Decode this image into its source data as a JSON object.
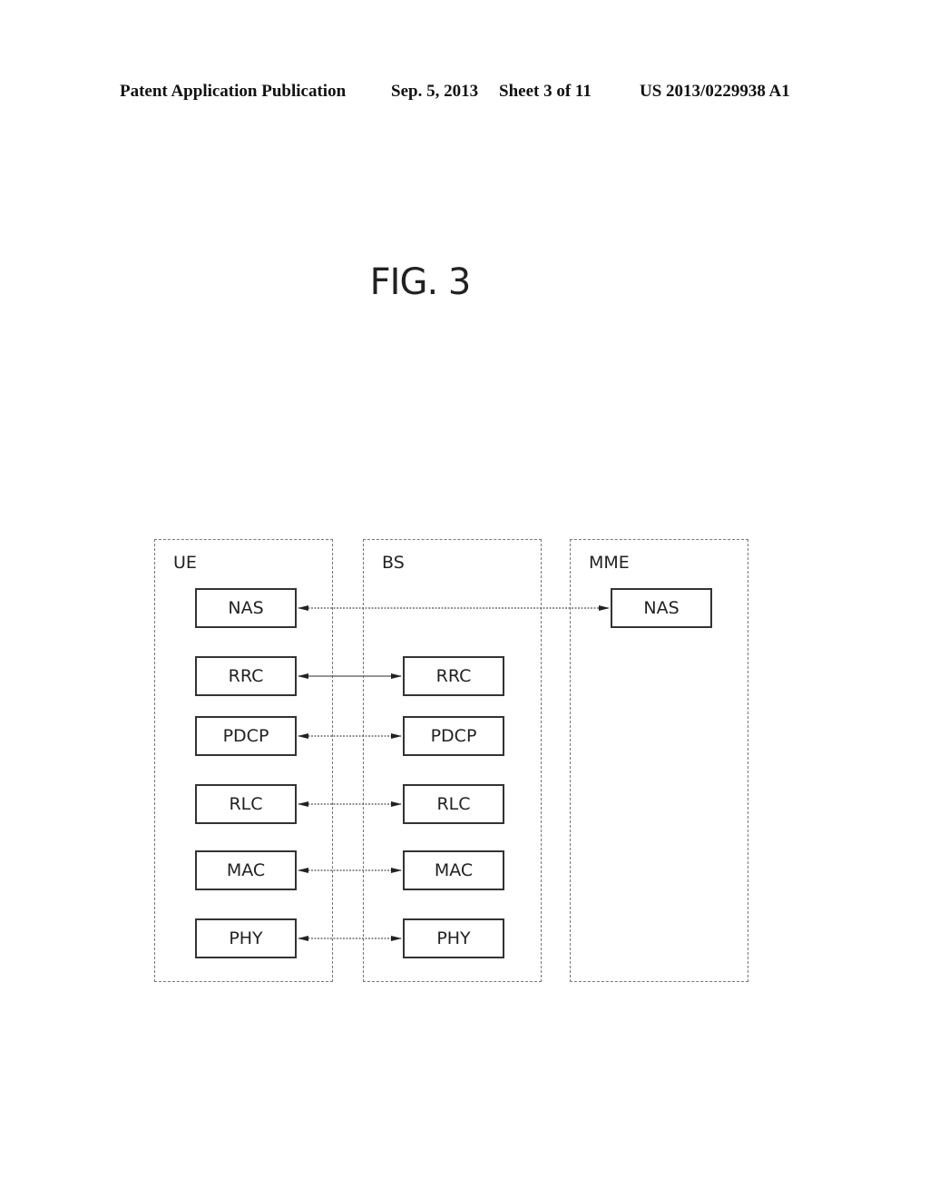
{
  "header": {
    "publication": "Patent Application Publication",
    "date": "Sep. 5, 2013",
    "sheet": "Sheet 3 of 11",
    "number": "US 2013/0229938 A1"
  },
  "figure": {
    "title": "FIG. 3"
  },
  "entities": [
    {
      "name": "UE",
      "layers": [
        "NAS",
        "RRC",
        "PDCP",
        "RLC",
        "MAC",
        "PHY"
      ]
    },
    {
      "name": "BS",
      "layers": [
        "RRC",
        "PDCP",
        "RLC",
        "MAC",
        "PHY"
      ]
    },
    {
      "name": "MME",
      "layers": [
        "NAS"
      ]
    }
  ],
  "links": [
    {
      "from": "UE.NAS",
      "to": "MME.NAS",
      "style": "dotted",
      "bidirectional": true
    },
    {
      "from": "UE.RRC",
      "to": "BS.RRC",
      "style": "solid",
      "bidirectional": true
    },
    {
      "from": "UE.PDCP",
      "to": "BS.PDCP",
      "style": "dotted",
      "bidirectional": true
    },
    {
      "from": "UE.RLC",
      "to": "BS.RLC",
      "style": "dotted",
      "bidirectional": true
    },
    {
      "from": "UE.MAC",
      "to": "BS.MAC",
      "style": "dotted",
      "bidirectional": true
    },
    {
      "from": "UE.PHY",
      "to": "BS.PHY",
      "style": "dotted",
      "bidirectional": true
    }
  ]
}
